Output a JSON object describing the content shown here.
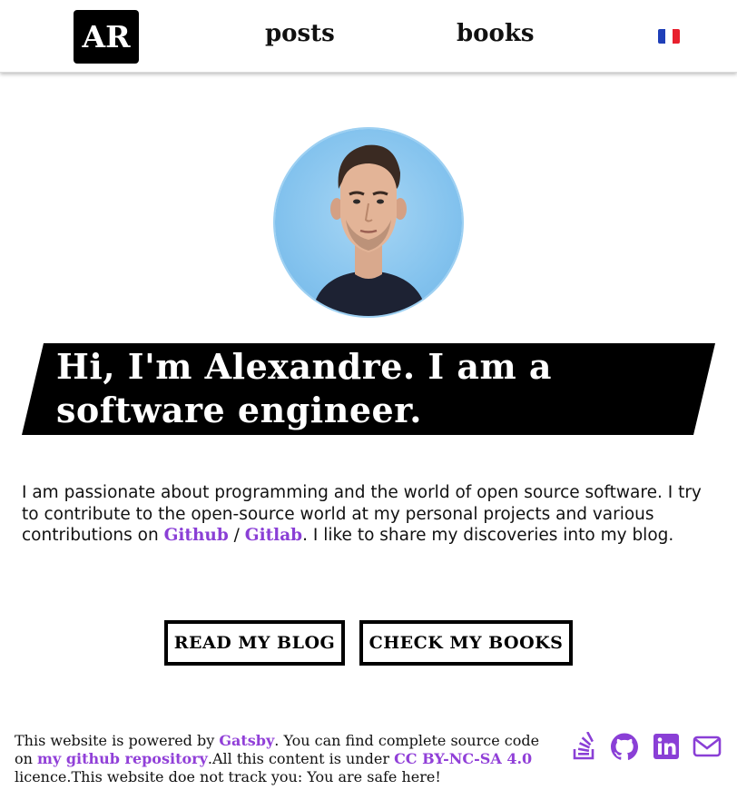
{
  "header": {
    "logo": "AR",
    "nav": {
      "posts": "posts",
      "books": "books"
    },
    "language_flag": "french-flag-icon"
  },
  "profile": {
    "avatar_alt": "profile photo"
  },
  "hero": {
    "title": "Hi, I'm Alexandre. I am a software engineer."
  },
  "intro": {
    "text_before": "I am passionate about programming and the world of open source software. I try to contribute to the open-source world at my personal projects and various contributions on ",
    "github_link": "Github",
    "separator": " / ",
    "gitlab_link": "Gitlab",
    "text_after": ". I like to share my discoveries into my blog."
  },
  "buttons": {
    "read_blog": "READ MY BLOG",
    "check_books": "CHECK MY BOOKS"
  },
  "footer": {
    "powered_by": "This website is powered by ",
    "gatsby_link": "Gatsby",
    "source_text": ". You can find complete source code on ",
    "repo_link": "my github repository",
    "license_text": ".All this content is under ",
    "license_link": "CC BY-NC-SA 4.0",
    "tracking_text": " licence.This website doe not track you: You are safe here!"
  },
  "social": {
    "icons": [
      "stackoverflow-icon",
      "github-icon",
      "linkedin-icon",
      "mail-icon"
    ],
    "color": "#8a3fd6"
  },
  "colors": {
    "accent": "#8a3fd6",
    "hero_background": "#000000",
    "avatar_background": "#84c3ee"
  }
}
